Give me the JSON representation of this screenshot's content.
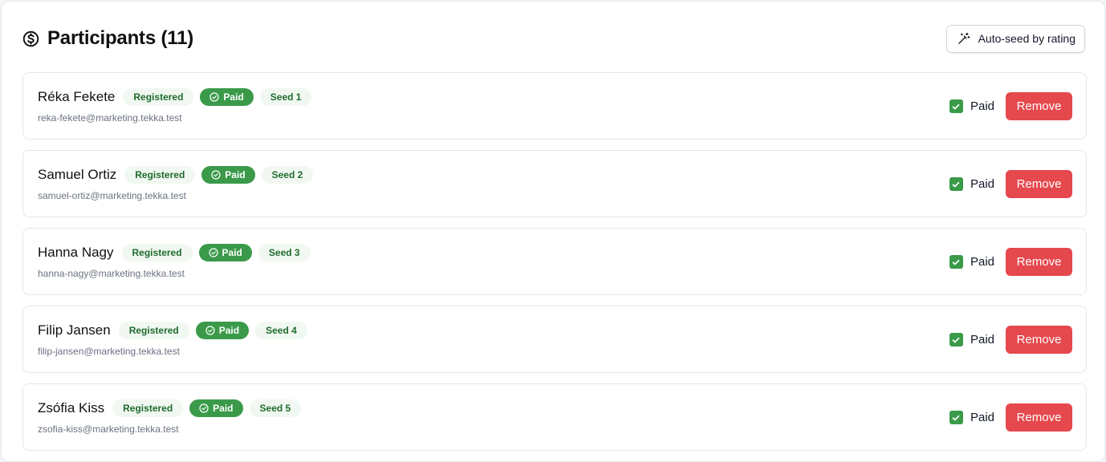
{
  "header": {
    "title": "Participants (11)",
    "autoseed_label": "Auto-seed by rating"
  },
  "participants": [
    {
      "name": "Réka Fekete",
      "email": "reka-fekete@marketing.tekka.test",
      "status": "Registered",
      "paid_badge": "Paid",
      "seed": "Seed 1",
      "paid_label": "Paid",
      "paid_checked": true,
      "remove_label": "Remove"
    },
    {
      "name": "Samuel Ortiz",
      "email": "samuel-ortiz@marketing.tekka.test",
      "status": "Registered",
      "paid_badge": "Paid",
      "seed": "Seed 2",
      "paid_label": "Paid",
      "paid_checked": true,
      "remove_label": "Remove"
    },
    {
      "name": "Hanna Nagy",
      "email": "hanna-nagy@marketing.tekka.test",
      "status": "Registered",
      "paid_badge": "Paid",
      "seed": "Seed 3",
      "paid_label": "Paid",
      "paid_checked": true,
      "remove_label": "Remove"
    },
    {
      "name": "Filip Jansen",
      "email": "filip-jansen@marketing.tekka.test",
      "status": "Registered",
      "paid_badge": "Paid",
      "seed": "Seed 4",
      "paid_label": "Paid",
      "paid_checked": true,
      "remove_label": "Remove"
    },
    {
      "name": "Zsófia Kiss",
      "email": "zsofia-kiss@marketing.tekka.test",
      "status": "Registered",
      "paid_badge": "Paid",
      "seed": "Seed 5",
      "paid_label": "Paid",
      "paid_checked": true,
      "remove_label": "Remove"
    }
  ],
  "colors": {
    "paid_green": "#3a9a4a",
    "badge_text_green": "#1e6b2e",
    "badge_bg_green": "#f1f8f1",
    "remove_red": "#e5484d"
  },
  "icons": {
    "title": "dollar-circle-icon",
    "autoseed": "magic-wand-icon",
    "paid_badge": "check-circle-icon",
    "checkbox": "checkmark-icon"
  }
}
